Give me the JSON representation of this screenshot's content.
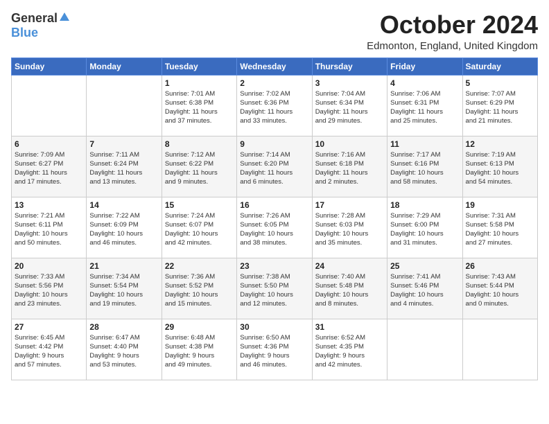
{
  "logo": {
    "general": "General",
    "blue": "Blue"
  },
  "title": "October 2024",
  "location": "Edmonton, England, United Kingdom",
  "days_of_week": [
    "Sunday",
    "Monday",
    "Tuesday",
    "Wednesday",
    "Thursday",
    "Friday",
    "Saturday"
  ],
  "weeks": [
    [
      {
        "day": "",
        "info": ""
      },
      {
        "day": "",
        "info": ""
      },
      {
        "day": "1",
        "info": "Sunrise: 7:01 AM\nSunset: 6:38 PM\nDaylight: 11 hours\nand 37 minutes."
      },
      {
        "day": "2",
        "info": "Sunrise: 7:02 AM\nSunset: 6:36 PM\nDaylight: 11 hours\nand 33 minutes."
      },
      {
        "day": "3",
        "info": "Sunrise: 7:04 AM\nSunset: 6:34 PM\nDaylight: 11 hours\nand 29 minutes."
      },
      {
        "day": "4",
        "info": "Sunrise: 7:06 AM\nSunset: 6:31 PM\nDaylight: 11 hours\nand 25 minutes."
      },
      {
        "day": "5",
        "info": "Sunrise: 7:07 AM\nSunset: 6:29 PM\nDaylight: 11 hours\nand 21 minutes."
      }
    ],
    [
      {
        "day": "6",
        "info": "Sunrise: 7:09 AM\nSunset: 6:27 PM\nDaylight: 11 hours\nand 17 minutes."
      },
      {
        "day": "7",
        "info": "Sunrise: 7:11 AM\nSunset: 6:24 PM\nDaylight: 11 hours\nand 13 minutes."
      },
      {
        "day": "8",
        "info": "Sunrise: 7:12 AM\nSunset: 6:22 PM\nDaylight: 11 hours\nand 9 minutes."
      },
      {
        "day": "9",
        "info": "Sunrise: 7:14 AM\nSunset: 6:20 PM\nDaylight: 11 hours\nand 6 minutes."
      },
      {
        "day": "10",
        "info": "Sunrise: 7:16 AM\nSunset: 6:18 PM\nDaylight: 11 hours\nand 2 minutes."
      },
      {
        "day": "11",
        "info": "Sunrise: 7:17 AM\nSunset: 6:16 PM\nDaylight: 10 hours\nand 58 minutes."
      },
      {
        "day": "12",
        "info": "Sunrise: 7:19 AM\nSunset: 6:13 PM\nDaylight: 10 hours\nand 54 minutes."
      }
    ],
    [
      {
        "day": "13",
        "info": "Sunrise: 7:21 AM\nSunset: 6:11 PM\nDaylight: 10 hours\nand 50 minutes."
      },
      {
        "day": "14",
        "info": "Sunrise: 7:22 AM\nSunset: 6:09 PM\nDaylight: 10 hours\nand 46 minutes."
      },
      {
        "day": "15",
        "info": "Sunrise: 7:24 AM\nSunset: 6:07 PM\nDaylight: 10 hours\nand 42 minutes."
      },
      {
        "day": "16",
        "info": "Sunrise: 7:26 AM\nSunset: 6:05 PM\nDaylight: 10 hours\nand 38 minutes."
      },
      {
        "day": "17",
        "info": "Sunrise: 7:28 AM\nSunset: 6:03 PM\nDaylight: 10 hours\nand 35 minutes."
      },
      {
        "day": "18",
        "info": "Sunrise: 7:29 AM\nSunset: 6:00 PM\nDaylight: 10 hours\nand 31 minutes."
      },
      {
        "day": "19",
        "info": "Sunrise: 7:31 AM\nSunset: 5:58 PM\nDaylight: 10 hours\nand 27 minutes."
      }
    ],
    [
      {
        "day": "20",
        "info": "Sunrise: 7:33 AM\nSunset: 5:56 PM\nDaylight: 10 hours\nand 23 minutes."
      },
      {
        "day": "21",
        "info": "Sunrise: 7:34 AM\nSunset: 5:54 PM\nDaylight: 10 hours\nand 19 minutes."
      },
      {
        "day": "22",
        "info": "Sunrise: 7:36 AM\nSunset: 5:52 PM\nDaylight: 10 hours\nand 15 minutes."
      },
      {
        "day": "23",
        "info": "Sunrise: 7:38 AM\nSunset: 5:50 PM\nDaylight: 10 hours\nand 12 minutes."
      },
      {
        "day": "24",
        "info": "Sunrise: 7:40 AM\nSunset: 5:48 PM\nDaylight: 10 hours\nand 8 minutes."
      },
      {
        "day": "25",
        "info": "Sunrise: 7:41 AM\nSunset: 5:46 PM\nDaylight: 10 hours\nand 4 minutes."
      },
      {
        "day": "26",
        "info": "Sunrise: 7:43 AM\nSunset: 5:44 PM\nDaylight: 10 hours\nand 0 minutes."
      }
    ],
    [
      {
        "day": "27",
        "info": "Sunrise: 6:45 AM\nSunset: 4:42 PM\nDaylight: 9 hours\nand 57 minutes."
      },
      {
        "day": "28",
        "info": "Sunrise: 6:47 AM\nSunset: 4:40 PM\nDaylight: 9 hours\nand 53 minutes."
      },
      {
        "day": "29",
        "info": "Sunrise: 6:48 AM\nSunset: 4:38 PM\nDaylight: 9 hours\nand 49 minutes."
      },
      {
        "day": "30",
        "info": "Sunrise: 6:50 AM\nSunset: 4:36 PM\nDaylight: 9 hours\nand 46 minutes."
      },
      {
        "day": "31",
        "info": "Sunrise: 6:52 AM\nSunset: 4:35 PM\nDaylight: 9 hours\nand 42 minutes."
      },
      {
        "day": "",
        "info": ""
      },
      {
        "day": "",
        "info": ""
      }
    ]
  ]
}
